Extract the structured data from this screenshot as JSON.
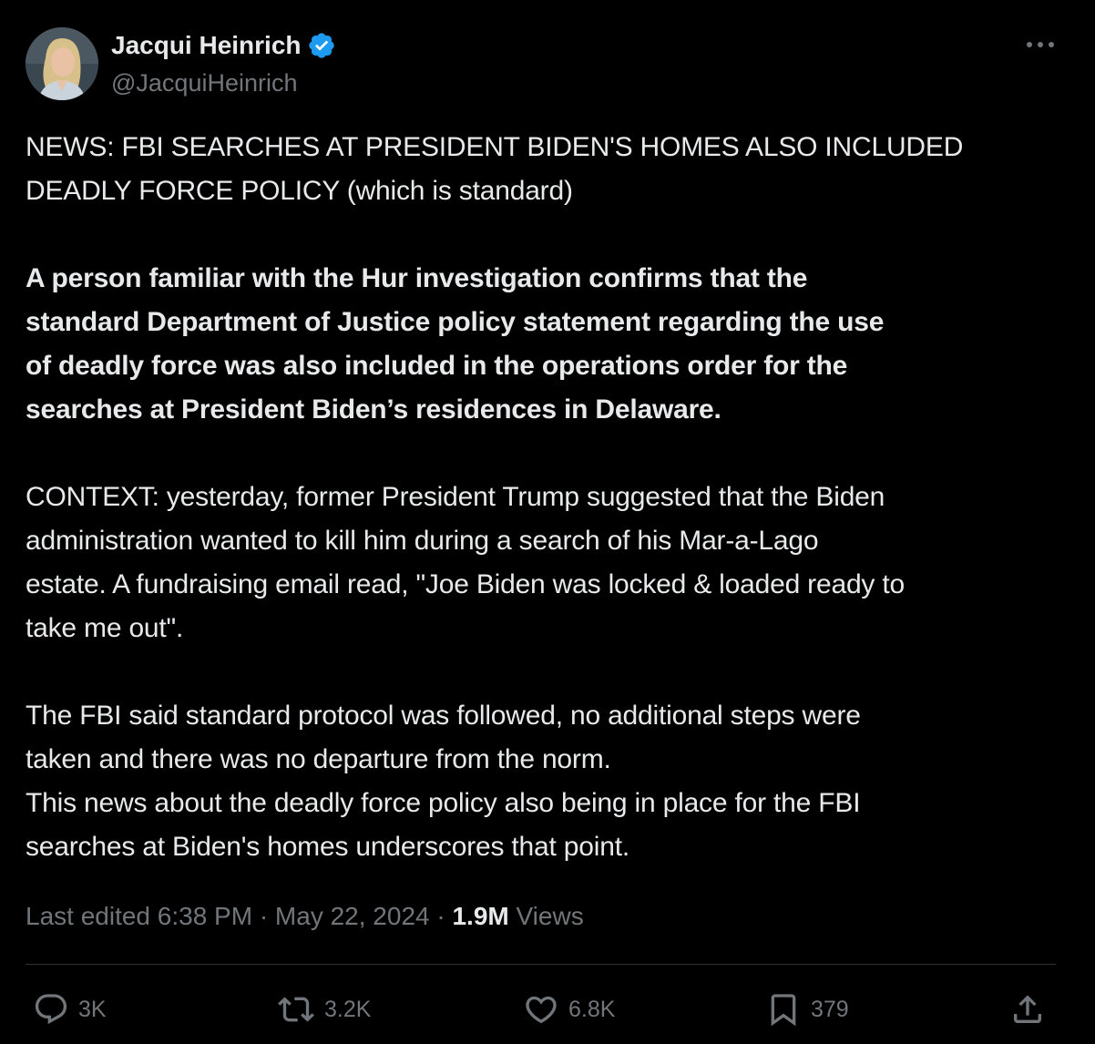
{
  "author": {
    "display_name": "Jacqui Heinrich",
    "handle": "@JacquiHeinrich",
    "verified": true
  },
  "tweet": {
    "headline": "NEWS: FBI SEARCHES AT PRESIDENT BIDEN'S HOMES ALSO INCLUDED\nDEADLY FORCE POLICY (which is standard)",
    "bold_paragraph": "A person familiar with the Hur investigation confirms that the\nstandard Department of Justice policy statement regarding the use\nof deadly force was also included in the operations order for the\nsearches at President Biden’s residences in Delaware.",
    "context_paragraph": "CONTEXT: yesterday, former President Trump suggested that the Biden\nadministration wanted to kill him during a search of his Mar-a-Lago\nestate. A fundraising email read, \"Joe Biden was locked & loaded ready to\ntake me out\".",
    "closing_paragraph": "The FBI said standard protocol was followed, no additional steps were\ntaken and there was no departure from the norm.\nThis news about the deadly force policy also being in place for the FBI\nsearches at Biden's homes underscores that point."
  },
  "meta": {
    "edited_time": "Last edited 6:38 PM · May 22, 2024 · ",
    "views_count": "1.9M",
    "views_label": " Views"
  },
  "actions": {
    "replies": "3K",
    "reposts": "3.2K",
    "likes": "6.8K",
    "bookmarks": "379"
  },
  "icons": {
    "verified": "verified-badge-icon",
    "more": "more-dots-icon",
    "reply": "reply-bubble-icon",
    "repost": "repost-icon",
    "like": "heart-icon",
    "bookmark": "bookmark-icon",
    "share": "share-upload-icon"
  },
  "colors": {
    "background": "#000000",
    "text_primary": "#e7e9ea",
    "text_secondary": "#71767b",
    "verified_blue": "#1d9bf0",
    "divider": "#2f3336"
  }
}
